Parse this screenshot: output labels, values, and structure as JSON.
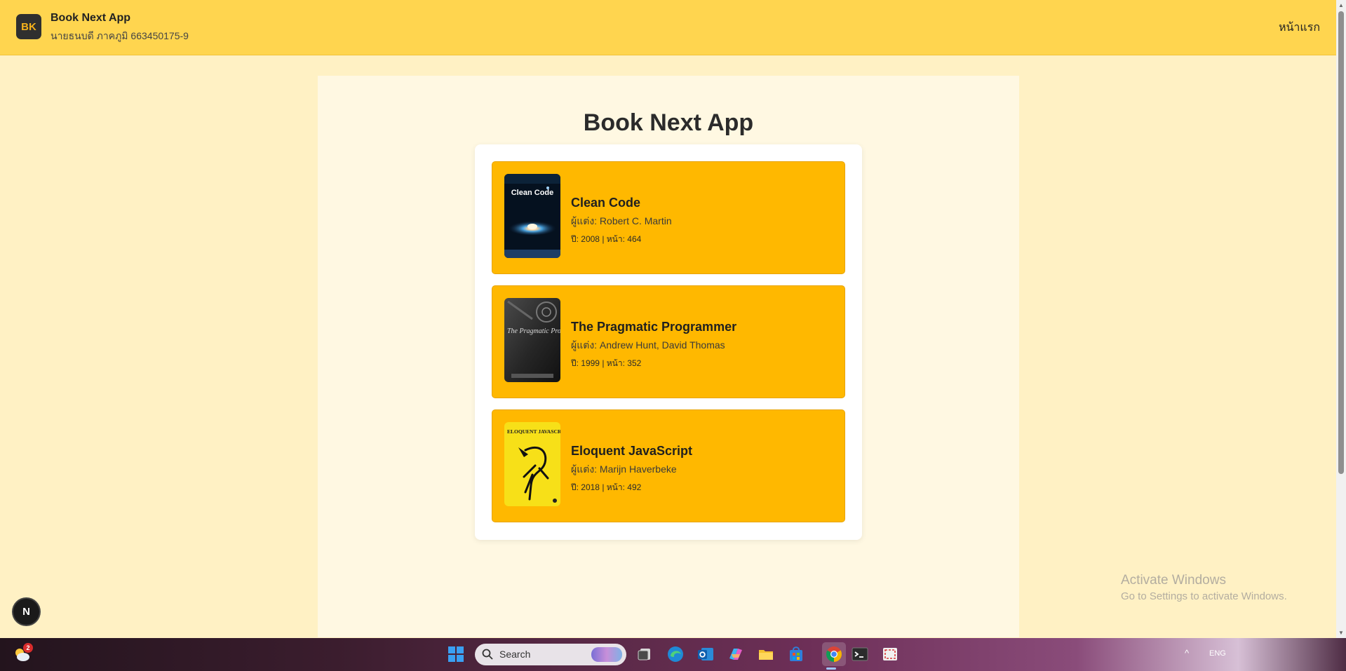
{
  "header": {
    "logo_text": "BK",
    "app_name": "Book Next App",
    "student": "นายธนบดี ภาคภูมิ 663450175-9",
    "nav_home": "หน้าแรก"
  },
  "main": {
    "title": "Book Next App",
    "books": [
      {
        "title": "Clean Code",
        "author": "ผู้แต่ง: Robert C. Martin",
        "meta": "ปี: 2008 | หน้า: 464",
        "cover_text": "Clean Code"
      },
      {
        "title": "The Pragmatic Programmer",
        "author": "ผู้แต่ง: Andrew Hunt, David Thomas",
        "meta": "ปี: 1999 | หน้า: 352",
        "cover_text": "The Pragmatic Programmer"
      },
      {
        "title": "Eloquent JavaScript",
        "author": "ผู้แต่ง: Marijn Haverbeke",
        "meta": "ปี: 2018 | หน้า: 492",
        "cover_text": "ELOQUENT JAVASCRIPT"
      }
    ]
  },
  "next_badge": "N",
  "watermark": {
    "line1": "Activate Windows",
    "line2": "Go to Settings to activate Windows."
  },
  "taskbar": {
    "weather_badge": "2",
    "search_placeholder": "Search",
    "language": "ENG",
    "icons": [
      "windows-start-icon",
      "task-view-icon",
      "edge-icon",
      "outlook-icon",
      "copilot-icon",
      "file-explorer-icon",
      "microsoft-store-icon",
      "chrome-icon",
      "terminal-icon",
      "snipping-tool-icon"
    ]
  },
  "colors": {
    "header_bg": "#ffd54f",
    "page_bg": "#fff1c4",
    "panel_bg": "#fff8e2",
    "card_bg": "#ffb800",
    "logo_bg": "#2f2f2f"
  }
}
